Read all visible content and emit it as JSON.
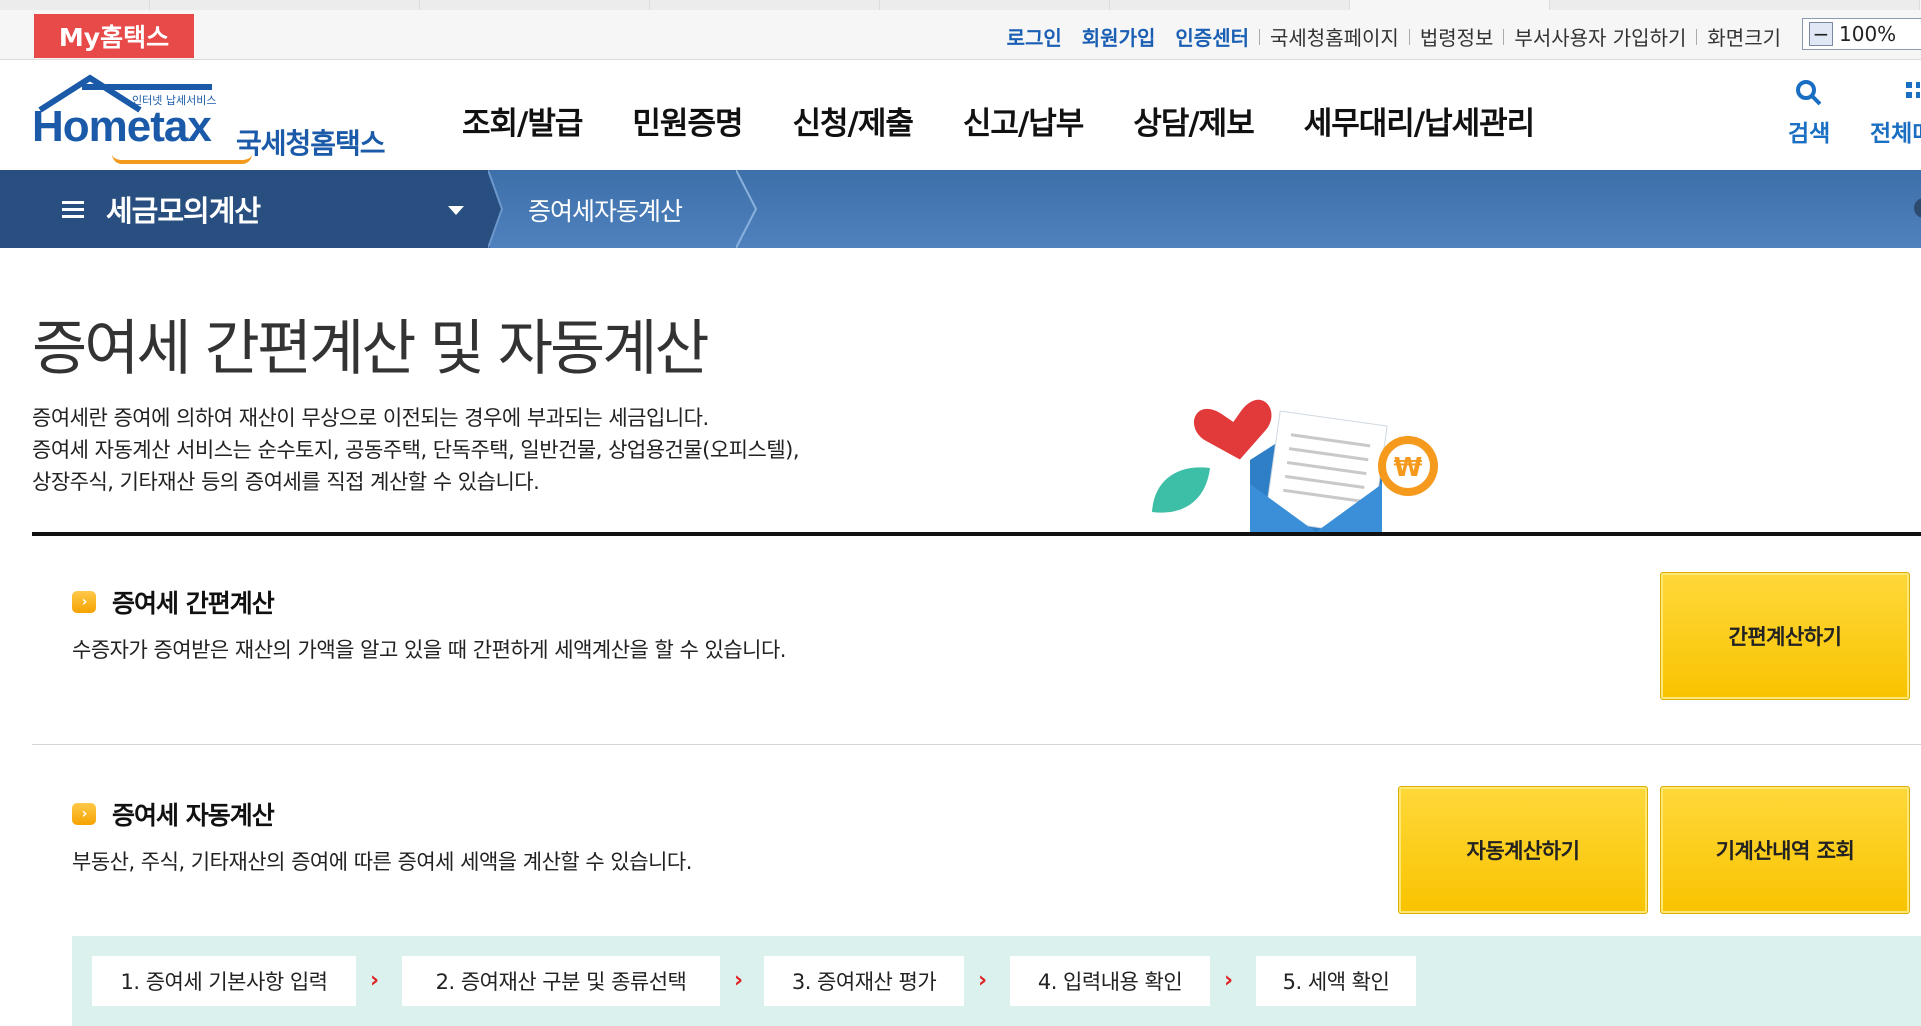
{
  "topbar": {
    "my_hometax": "My홈택스",
    "links": [
      {
        "label": "로그인",
        "emph": true
      },
      {
        "label": "회원가입",
        "emph": true
      },
      {
        "label": "인증센터",
        "emph": true
      },
      {
        "label": "국세청홈페이지",
        "emph": false
      },
      {
        "label": "법령정보",
        "emph": false
      },
      {
        "label": "부서사용자 가입하기",
        "emph": false
      },
      {
        "label": "화면크기",
        "emph": false
      }
    ],
    "zoom_value": "100%"
  },
  "header": {
    "logo_text": "Hometax",
    "logo_small": "인터넷 납세서비스",
    "logo_korean": "국세청홈택스",
    "gnb": [
      "조회/발급",
      "민원증명",
      "신청/제출",
      "신고/납부",
      "상담/제보",
      "세무대리/납세관리"
    ],
    "search_label": "검색",
    "allmenu_label": "전체메뉴"
  },
  "location": {
    "menu": "세금모의계산",
    "current": "증여세자동계산"
  },
  "page": {
    "title": "증여세 간편계산 및 자동계산",
    "desc_lines": [
      "증여세란 증여에 의하여 재산이 무상으로 이전되는 경우에 부과되는 세금입니다.",
      "증여세 자동계산 서비스는 순수토지, 공동주택, 단독주택, 일반건물, 상업용건물(오피스텔),",
      "상장주식, 기타재산 등의 증여세를 직접 계산할 수 있습니다."
    ]
  },
  "simple": {
    "title": "증여세 간편계산",
    "desc": "수증자가 증여받은 재산의 가액을 알고 있을 때 간편하게 세액계산을 할 수 있습니다.",
    "button": "간편계산하기"
  },
  "auto": {
    "title": "증여세 자동계산",
    "desc": "부동산, 주식, 기타재산의 증여에 따른 증여세 세액을 계산할 수 있습니다.",
    "button_auto": "자동계산하기",
    "button_history": "기계산내역 조회"
  },
  "steps": [
    "1. 증여세 기본사항 입력",
    "2. 증여재산 구분 및 종류선택",
    "3. 증여재산 평가",
    "4. 입력내용 확인",
    "5. 세액 확인"
  ],
  "colors": {
    "brand_blue": "#1a5aa8",
    "nav_dark": "#284f80",
    "nav_light": "#4f82be",
    "button_yellow": "#f8c300",
    "my_red": "#e84a4a",
    "steps_bg": "#daf1ee"
  }
}
